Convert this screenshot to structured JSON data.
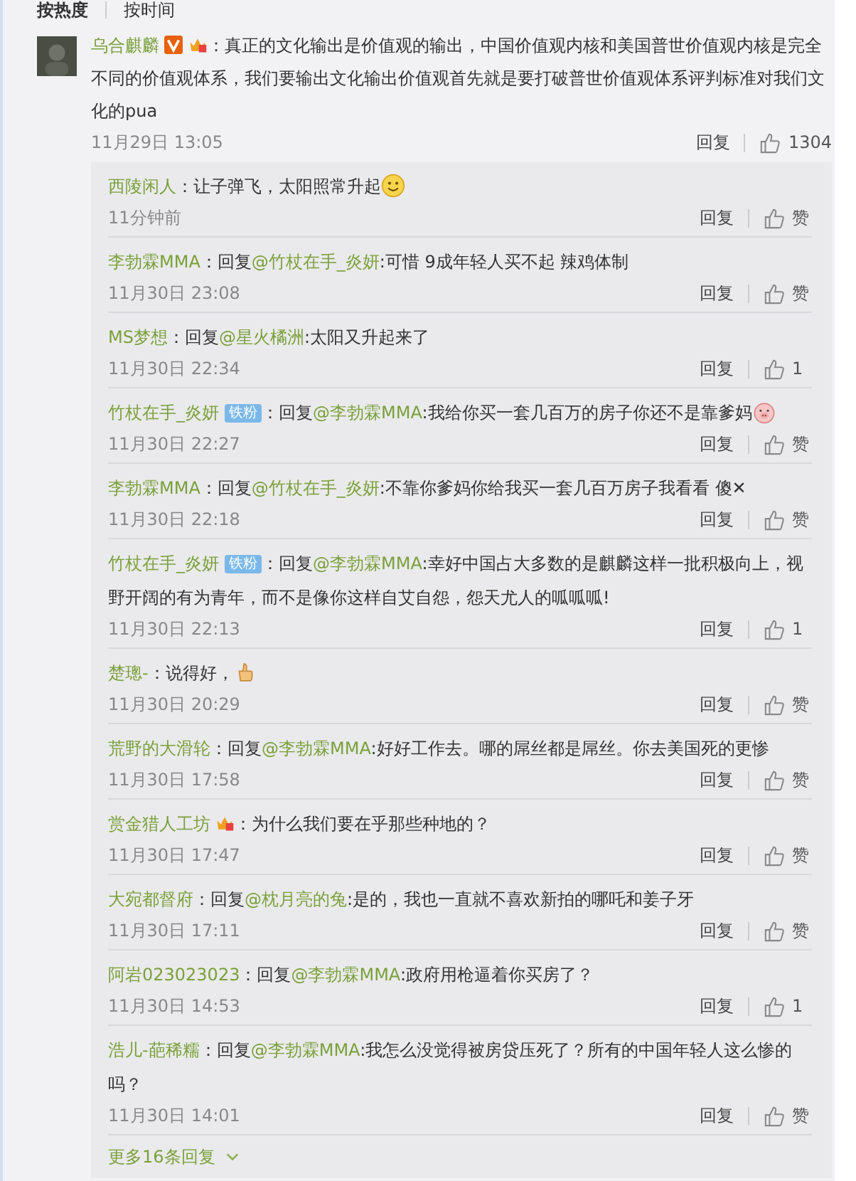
{
  "sort_tabs": [
    {
      "label": "按热度",
      "selected": true
    },
    {
      "label": "按时间",
      "selected": false
    }
  ],
  "comment": {
    "user": "乌合麒麟",
    "badges": [
      {
        "kind": "verified"
      },
      {
        "kind": "crown"
      }
    ],
    "text": "：真正的文化输出是价值观的输出，中国价值观内核和美国普世价值观内核是完全不同的价值观体系，我们要输出文化输出价值观首先就是要打破普世价值观体系评判标准对我们文化的pua",
    "time": "11月29日 13:05",
    "reply_label": "回复",
    "likes": "1304"
  },
  "replies": [
    {
      "user": "西陵闲人",
      "text": "：让子弹飞，太阳照常升起",
      "emoji": {
        "kind": "smile"
      },
      "time": "11分钟前",
      "reply_label": "回复",
      "likes": "赞"
    },
    {
      "user": "李勃霖MMA",
      "prefix": "：回复",
      "reply_to": "@竹杖在手_炎妍",
      "text": ":可惜 9成年轻人买不起  辣鸡体制",
      "time": "11月30日 23:08",
      "reply_label": "回复",
      "likes": "赞"
    },
    {
      "user": "MS梦想",
      "prefix": "：回复",
      "reply_to": "@星火橘洲",
      "text": ":太阳又升起来了",
      "time": "11月30日 22:34",
      "reply_label": "回复",
      "likes": "1"
    },
    {
      "user": "竹杖在手_炎妍",
      "fan_badge": "铁粉",
      "prefix": "：回复",
      "reply_to": "@李勃霖MMA",
      "text": ":我给你买一套几百万的房子你还不是靠爹妈",
      "emoji": {
        "kind": "pig"
      },
      "time": "11月30日 22:27",
      "reply_label": "回复",
      "likes": "赞"
    },
    {
      "user": "李勃霖MMA",
      "prefix": "：回复",
      "reply_to": "@竹杖在手_炎妍",
      "text": ":不靠你爹妈你给我买一套几百万房子我看看 傻✕",
      "time": "11月30日 22:18",
      "reply_label": "回复",
      "likes": "赞"
    },
    {
      "user": "竹杖在手_炎妍",
      "fan_badge": "铁粉",
      "prefix": "：回复",
      "reply_to": "@李勃霖MMA",
      "text": ":幸好中国占大多数的是麒麟这样一批积极向上，视野开阔的有为青年，而不是像你这样自艾自怨，怨天尤人的呱呱呱!",
      "time": "11月30日 22:13",
      "reply_label": "回复",
      "likes": "1"
    },
    {
      "user": "楚璁-",
      "text": "：说得好，",
      "emoji": {
        "kind": "thumb"
      },
      "time": "11月30日 20:29",
      "reply_label": "回复",
      "likes": "赞"
    },
    {
      "user": "荒野的大滑轮",
      "prefix": "：回复",
      "reply_to": "@李勃霖MMA",
      "text": ":好好工作去。哪的屌丝都是屌丝。你去美国死的更惨",
      "time": "11月30日 17:58",
      "reply_label": "回复",
      "likes": "赞"
    },
    {
      "user": "赏金猎人工坊",
      "badge": {
        "kind": "crown"
      },
      "text": "：为什么我们要在乎那些种地的？",
      "time": "11月30日 17:47",
      "reply_label": "回复",
      "likes": "赞"
    },
    {
      "user": "大宛都督府",
      "prefix": "：回复",
      "reply_to": "@枕月亮的兔",
      "text": ":是的，我也一直就不喜欢新拍的哪吒和姜子牙",
      "time": "11月30日 17:11",
      "reply_label": "回复",
      "likes": "赞"
    },
    {
      "user": "阿岩023023023",
      "prefix": "：回复",
      "reply_to": "@李勃霖MMA",
      "text": ":政府用枪逼着你买房了？",
      "time": "11月30日 14:53",
      "reply_label": "回复",
      "likes": "1"
    },
    {
      "user": "浩儿-葩稀糯",
      "prefix": "：回复",
      "reply_to": "@李勃霖MMA",
      "text": ":我怎么没觉得被房贷压死了？所有的中国年轻人这么惨的吗？",
      "time": "11月30日 14:01",
      "reply_label": "回复",
      "likes": "赞"
    }
  ],
  "more_replies": "更多16条回复"
}
